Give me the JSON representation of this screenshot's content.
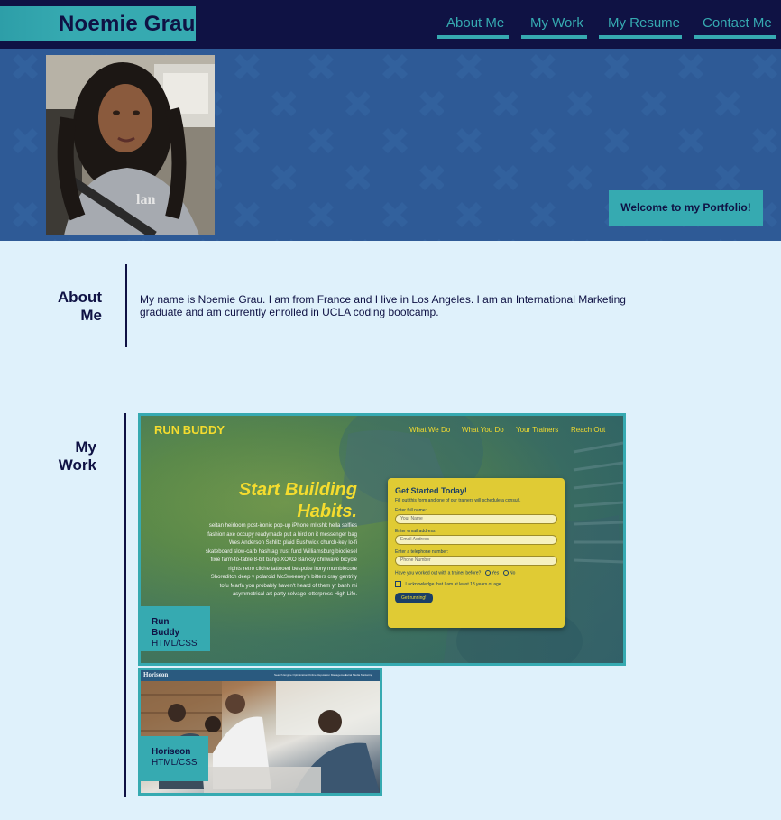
{
  "header": {
    "brand": "Noemie Grau",
    "nav": [
      "About Me",
      "My Work",
      "My Resume",
      "Contact Me"
    ]
  },
  "hero": {
    "welcome": "Welcome to my Portfolio!"
  },
  "about": {
    "title_line1": "About",
    "title_line2": "Me",
    "text": "My name is Noemie Grau. I am from France and I live in Los Angeles. I am an International Marketing graduate and am currently enrolled in UCLA coding bootcamp."
  },
  "work": {
    "title_line1": "My",
    "title_line2": "Work",
    "projects": [
      {
        "name": "Run Buddy",
        "tech": "HTML/CSS"
      },
      {
        "name": "Horiseon",
        "tech": "HTML/CSS"
      }
    ]
  },
  "run_buddy_preview": {
    "logo": "RUN BUDDY",
    "nav": [
      "What We Do",
      "What You Do",
      "Your Trainers",
      "Reach Out"
    ],
    "hero_line1": "Start Building",
    "hero_line2": "Habits.",
    "body": "seitan heirloom post-ironic pop-up iPhone mlkshk hella selfies fashion axe occupy readymade put a bird on it messenger bag Wes Anderson Schlitz plaid Bushwick church-key lo-fi skateboard slow-carb hashtag trust fund Williamsburg biodiesel fixie farm-to-table 8-bit banjo XOXO Banksy chillwave bicycle rights retro cliche tattooed bespoke irony mumblecore Shoreditch deep v polaroid McSweeney's bitters cray gentrify tofu Marfa you probably haven't heard of them yr banh mi asymmetrical art party selvage letterpress High Life.",
    "form_title": "Get Started Today!",
    "form_sub": "Fill out this form and one of our trainers will schedule a consult.",
    "label_name": "Enter full name:",
    "ph_name": "Your Name",
    "label_email": "Enter email address:",
    "ph_email": "Email Address",
    "label_phone": "Enter a telephone number:",
    "ph_phone": "Phone Number",
    "question": "Have you worked out with a trainer before?",
    "yes": "Yes",
    "no": "No",
    "ack": "I acknowledge that I am at least 18 years of age.",
    "button": "Get running!"
  },
  "horiseon_preview": {
    "logo": "Horiseon",
    "nav": [
      "Search Engine Optimization",
      "Online Reputation Management",
      "Social Media Marketing"
    ]
  },
  "colors": {
    "navy": "#0f1244",
    "teal": "#36aab1",
    "hero_blue": "#2e5a96",
    "page_bg": "#dff1fb",
    "rb_yellow": "#f5dc2e"
  }
}
